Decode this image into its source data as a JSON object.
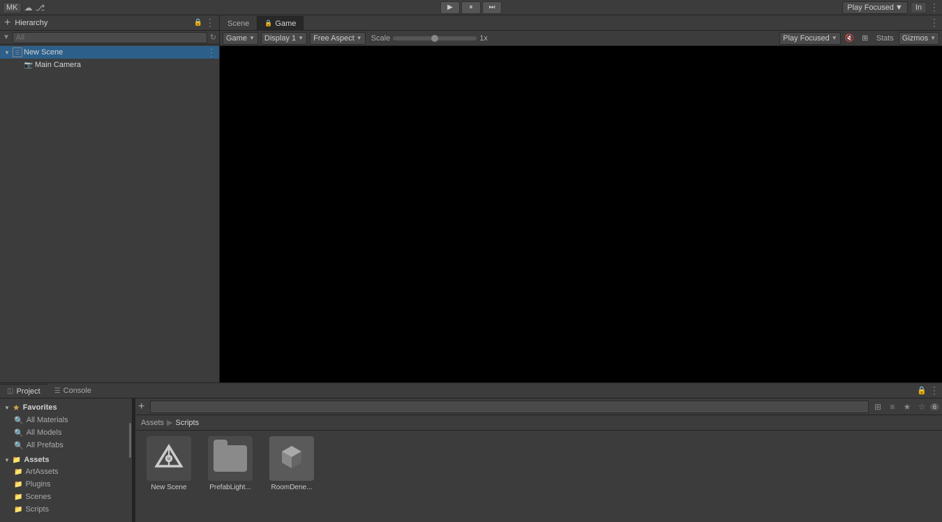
{
  "topbar": {
    "mk_label": "MK",
    "play_icon": "▶",
    "pause_icon": "⏸",
    "step_icon": "⏭",
    "focused_play_label": "Play Focused",
    "focused_play_dropdown": "▼",
    "info_label": "In",
    "info_dropdown": "▼"
  },
  "hierarchy": {
    "title": "Hierarchy",
    "search_placeholder": "All",
    "items": [
      {
        "label": "New Scene",
        "type": "scene",
        "level": 0,
        "expanded": true
      },
      {
        "label": "Main Camera",
        "type": "camera",
        "level": 1
      }
    ]
  },
  "tabs": {
    "scene_tab": "Scene",
    "game_tab": "Game"
  },
  "game_toolbar": {
    "display_label": "Game",
    "display_dropdown": "▼",
    "display1_label": "Display 1",
    "display1_dropdown": "▼",
    "free_aspect_label": "Free Aspect",
    "free_aspect_dropdown": "▼",
    "scale_label": "Scale",
    "scale_value": "1x",
    "play_focused_label": "Play Focused",
    "play_focused_dropdown": "▼",
    "stats_label": "Stats",
    "gizmos_label": "Gizmos",
    "gizmos_dropdown": "▼"
  },
  "bottom_tabs": {
    "project_tab": "Project",
    "console_tab": "Console"
  },
  "project": {
    "add_btn": "+",
    "search_placeholder": "",
    "breadcrumb": {
      "assets": "Assets",
      "sep": "▶",
      "scripts": "Scripts"
    },
    "sidebar": {
      "favorites_label": "Favorites",
      "all_materials": "All Materials",
      "all_models": "All Models",
      "all_prefabs": "All Prefabs",
      "assets_label": "Assets",
      "art_assets": "ArtAssets",
      "plugins": "Plugins",
      "scenes": "Scenes",
      "scripts": "Scripts"
    },
    "assets": [
      {
        "name": "New Scene",
        "type": "unity-scene"
      },
      {
        "name": "PrefabLight...",
        "type": "folder"
      },
      {
        "name": "RoomDene...",
        "type": "3d-object"
      }
    ],
    "badge": "6"
  }
}
